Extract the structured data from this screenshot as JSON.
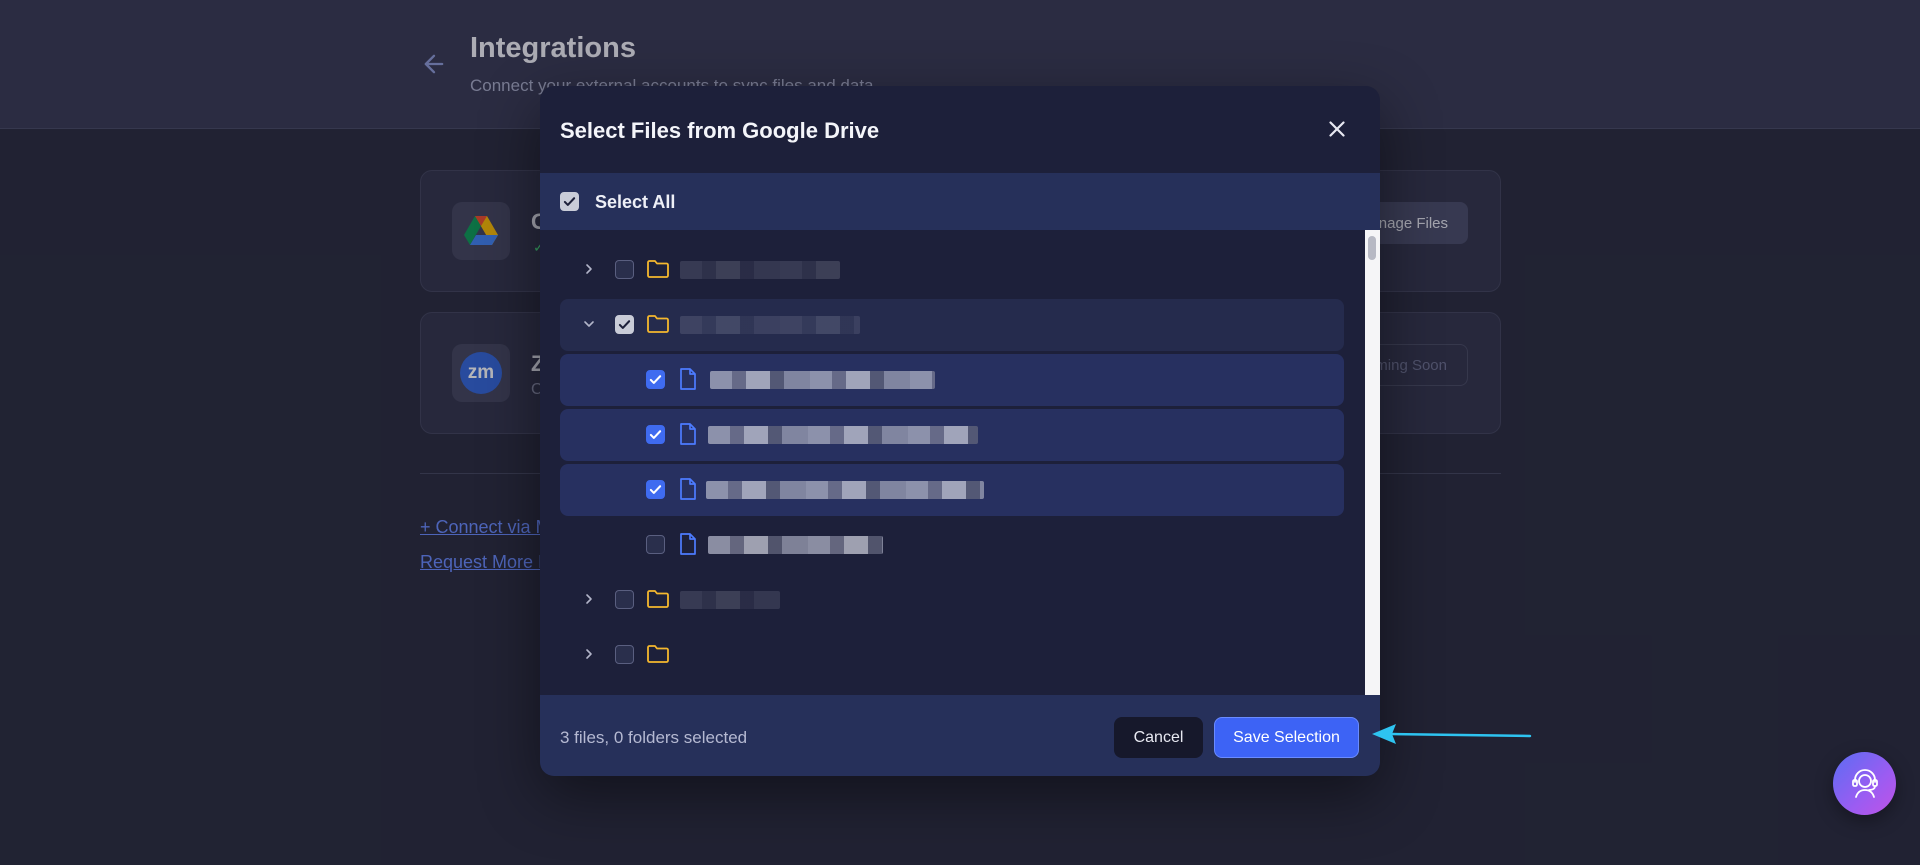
{
  "page": {
    "title": "Integrations",
    "subtitle": "Connect your external accounts to sync files and data"
  },
  "integrations": [
    {
      "name": "G",
      "status": "✓",
      "button": "Manage Files"
    },
    {
      "name": "Z",
      "subtitle": "C",
      "button": "Coming Soon"
    }
  ],
  "links": {
    "connect": "+ Connect via M",
    "request": "Request More I"
  },
  "modal": {
    "title": "Select Files from Google Drive",
    "select_all": "Select All",
    "selection_count": "3 files, 0 folders selected",
    "cancel": "Cancel",
    "save": "Save Selection"
  },
  "icons": {
    "back": "arrow-left-icon",
    "close": "close-icon",
    "folder": "folder-icon",
    "file": "file-icon",
    "help": "support-agent-icon"
  },
  "colors": {
    "accent": "#3d63f5",
    "folder": "#f5b82e",
    "file": "#4d7cff",
    "annotation_arrow": "#2ec4f1"
  }
}
